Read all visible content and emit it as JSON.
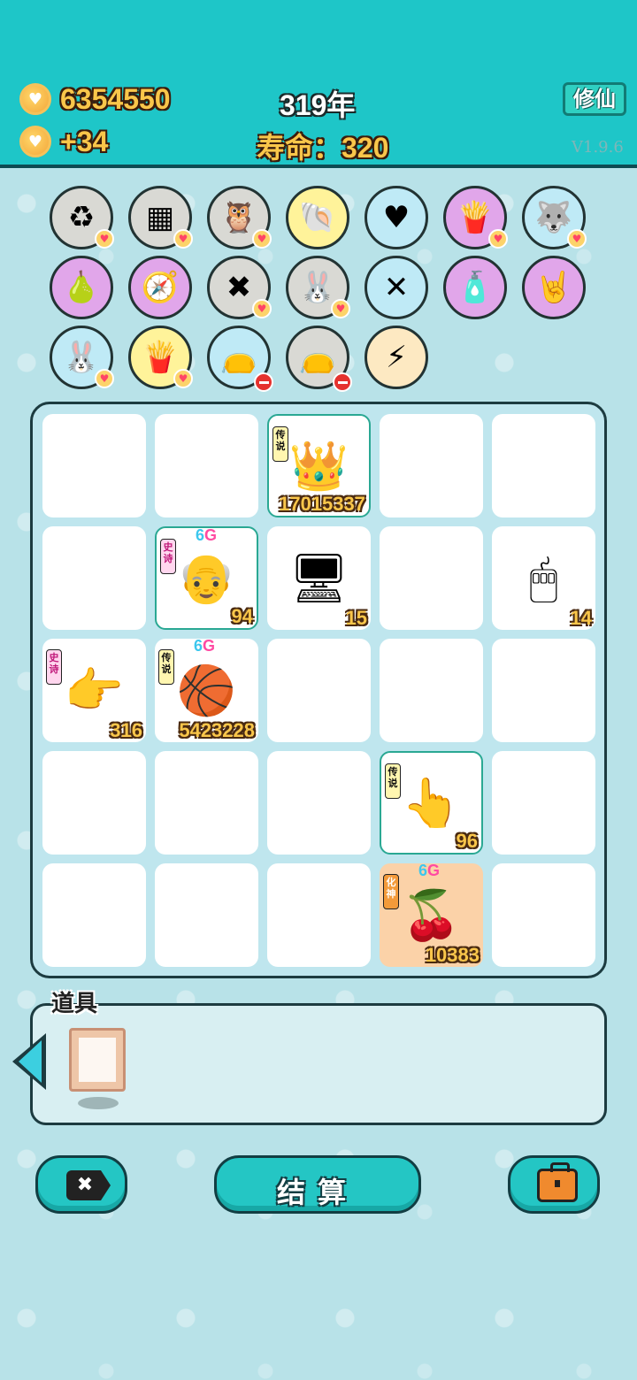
{
  "header": {
    "coins": "6354550",
    "coin_rate": "+34",
    "year": "319年",
    "lifespan": "寿命：320",
    "xiuxian_label": "修仙",
    "version": "V1.9.6"
  },
  "items": [
    {
      "name": "refresh-item",
      "icon": "recycle-icon",
      "glyph": "♻",
      "bg": "#d9d9d4",
      "badge": "heart"
    },
    {
      "name": "sugar-cubes-item",
      "icon": "sugar-cubes-icon",
      "glyph": "▦",
      "bg": "#d9d9d4",
      "badge": "heart"
    },
    {
      "name": "owls-item",
      "icon": "owl-icon",
      "glyph": "🦉",
      "bg": "#d9d9d4",
      "badge": "heart"
    },
    {
      "name": "shell-item",
      "icon": "shell-icon",
      "glyph": "🐚",
      "bg": "#fff39a",
      "badge": "none"
    },
    {
      "name": "heart-fan-item",
      "icon": "heart-fan-icon",
      "glyph": "♥",
      "bg": "#bfeaf6",
      "badge": "none"
    },
    {
      "name": "fries-item",
      "icon": "fries-icon",
      "glyph": "🍟",
      "bg": "#e1a6ea",
      "badge": "heart"
    },
    {
      "name": "husky-item",
      "icon": "husky-icon",
      "glyph": "🐺",
      "bg": "#bfeaf6",
      "badge": "heart"
    },
    {
      "name": "pomelo-item",
      "icon": "pomelo-icon",
      "glyph": "🍐",
      "bg": "#e1a6ea",
      "badge": "none"
    },
    {
      "name": "compass-item",
      "icon": "compass-icon",
      "glyph": "🧭",
      "bg": "#e1a6ea",
      "badge": "none"
    },
    {
      "name": "delete-tag-item",
      "icon": "delete-tag-icon",
      "glyph": "✖",
      "bg": "#d9d9d4",
      "badge": "heart"
    },
    {
      "name": "rabbit-item",
      "icon": "rabbit-icon",
      "glyph": "🐰",
      "bg": "#d9d9d4",
      "badge": "heart"
    },
    {
      "name": "chopsticks-item",
      "icon": "chopsticks-icon",
      "glyph": "✕",
      "bg": "#bfeaf6",
      "badge": "none"
    },
    {
      "name": "spray-bottle-item",
      "icon": "spray-bottle-icon",
      "glyph": "🧴",
      "bg": "#e1a6ea",
      "badge": "none"
    },
    {
      "name": "rock-hand-item",
      "icon": "rock-hand-icon",
      "glyph": "🤘",
      "bg": "#e1a6ea",
      "badge": "none"
    },
    {
      "name": "rabbit-item-2",
      "icon": "rabbit-icon",
      "glyph": "🐰",
      "bg": "#bfeaf6",
      "badge": "heart"
    },
    {
      "name": "fries-item-2",
      "icon": "fries-icon",
      "glyph": "🍟",
      "bg": "#fff39a",
      "badge": "heart"
    },
    {
      "name": "bag-item",
      "icon": "money-bag-icon",
      "glyph": "👝",
      "bg": "#bfeaf6",
      "badge": "minus"
    },
    {
      "name": "bag-item-2",
      "icon": "money-bag-icon",
      "glyph": "👝",
      "bg": "#d9d9d4",
      "badge": "minus"
    },
    {
      "name": "lightning-item",
      "icon": "lightning-icon",
      "glyph": "⚡",
      "bg": "#fde9c2",
      "badge": "none"
    }
  ],
  "board": {
    "cells": [
      {
        "row": 0,
        "col": 2,
        "name": "king-cell",
        "icon": "king-face-icon",
        "glyph": "👑",
        "rank": "传说",
        "rank_style": "legend",
        "g6": false,
        "value": "17015337",
        "highlight": true,
        "orange": false
      },
      {
        "row": 1,
        "col": 1,
        "name": "farmer-cell",
        "icon": "old-farmer-icon",
        "glyph": "👴",
        "rank": "史诗",
        "rank_style": "epic",
        "g6": true,
        "value": "94",
        "highlight": true,
        "orange": false
      },
      {
        "row": 1,
        "col": 2,
        "name": "monitor-cell",
        "icon": "monitor-icon",
        "glyph": "🖥",
        "rank": "",
        "rank_style": "",
        "g6": false,
        "value": "15",
        "highlight": false,
        "orange": false
      },
      {
        "row": 1,
        "col": 4,
        "name": "mouse-cell",
        "icon": "computer-mouse-icon",
        "glyph": "🖱",
        "rank": "",
        "rank_style": "",
        "g6": false,
        "value": "14",
        "highlight": false,
        "orange": false
      },
      {
        "row": 2,
        "col": 0,
        "name": "pointing-hand-cell",
        "icon": "pointing-hand-icon",
        "glyph": "👉",
        "rank": "史诗",
        "rank_style": "epic",
        "g6": false,
        "value": "316",
        "highlight": false,
        "orange": false
      },
      {
        "row": 2,
        "col": 1,
        "name": "basketball-cell",
        "icon": "basketball-icon",
        "glyph": "🏀",
        "rank": "传说",
        "rank_style": "legend",
        "g6": true,
        "value": "5423228",
        "highlight": false,
        "orange": false
      },
      {
        "row": 3,
        "col": 3,
        "name": "golden-hand-cell",
        "icon": "golden-hand-icon",
        "glyph": "👆",
        "rank": "传说",
        "rank_style": "legend",
        "g6": false,
        "value": "96",
        "highlight": true,
        "orange": false
      },
      {
        "row": 4,
        "col": 3,
        "name": "cherries-cell",
        "icon": "cherries-icon",
        "glyph": "🍒",
        "rank": "化神",
        "rank_style": "huashen",
        "g6": true,
        "value": "10383",
        "highlight": false,
        "orange": true
      }
    ],
    "g6_label_a": "6",
    "g6_label_b": "G"
  },
  "props_panel": {
    "label": "道具",
    "items": [
      {
        "name": "frame-item",
        "icon": "picture-frame-icon"
      }
    ]
  },
  "bottom": {
    "discard_label": "✖",
    "settle_label": "结算",
    "bag_icon": "briefcase-icon"
  }
}
